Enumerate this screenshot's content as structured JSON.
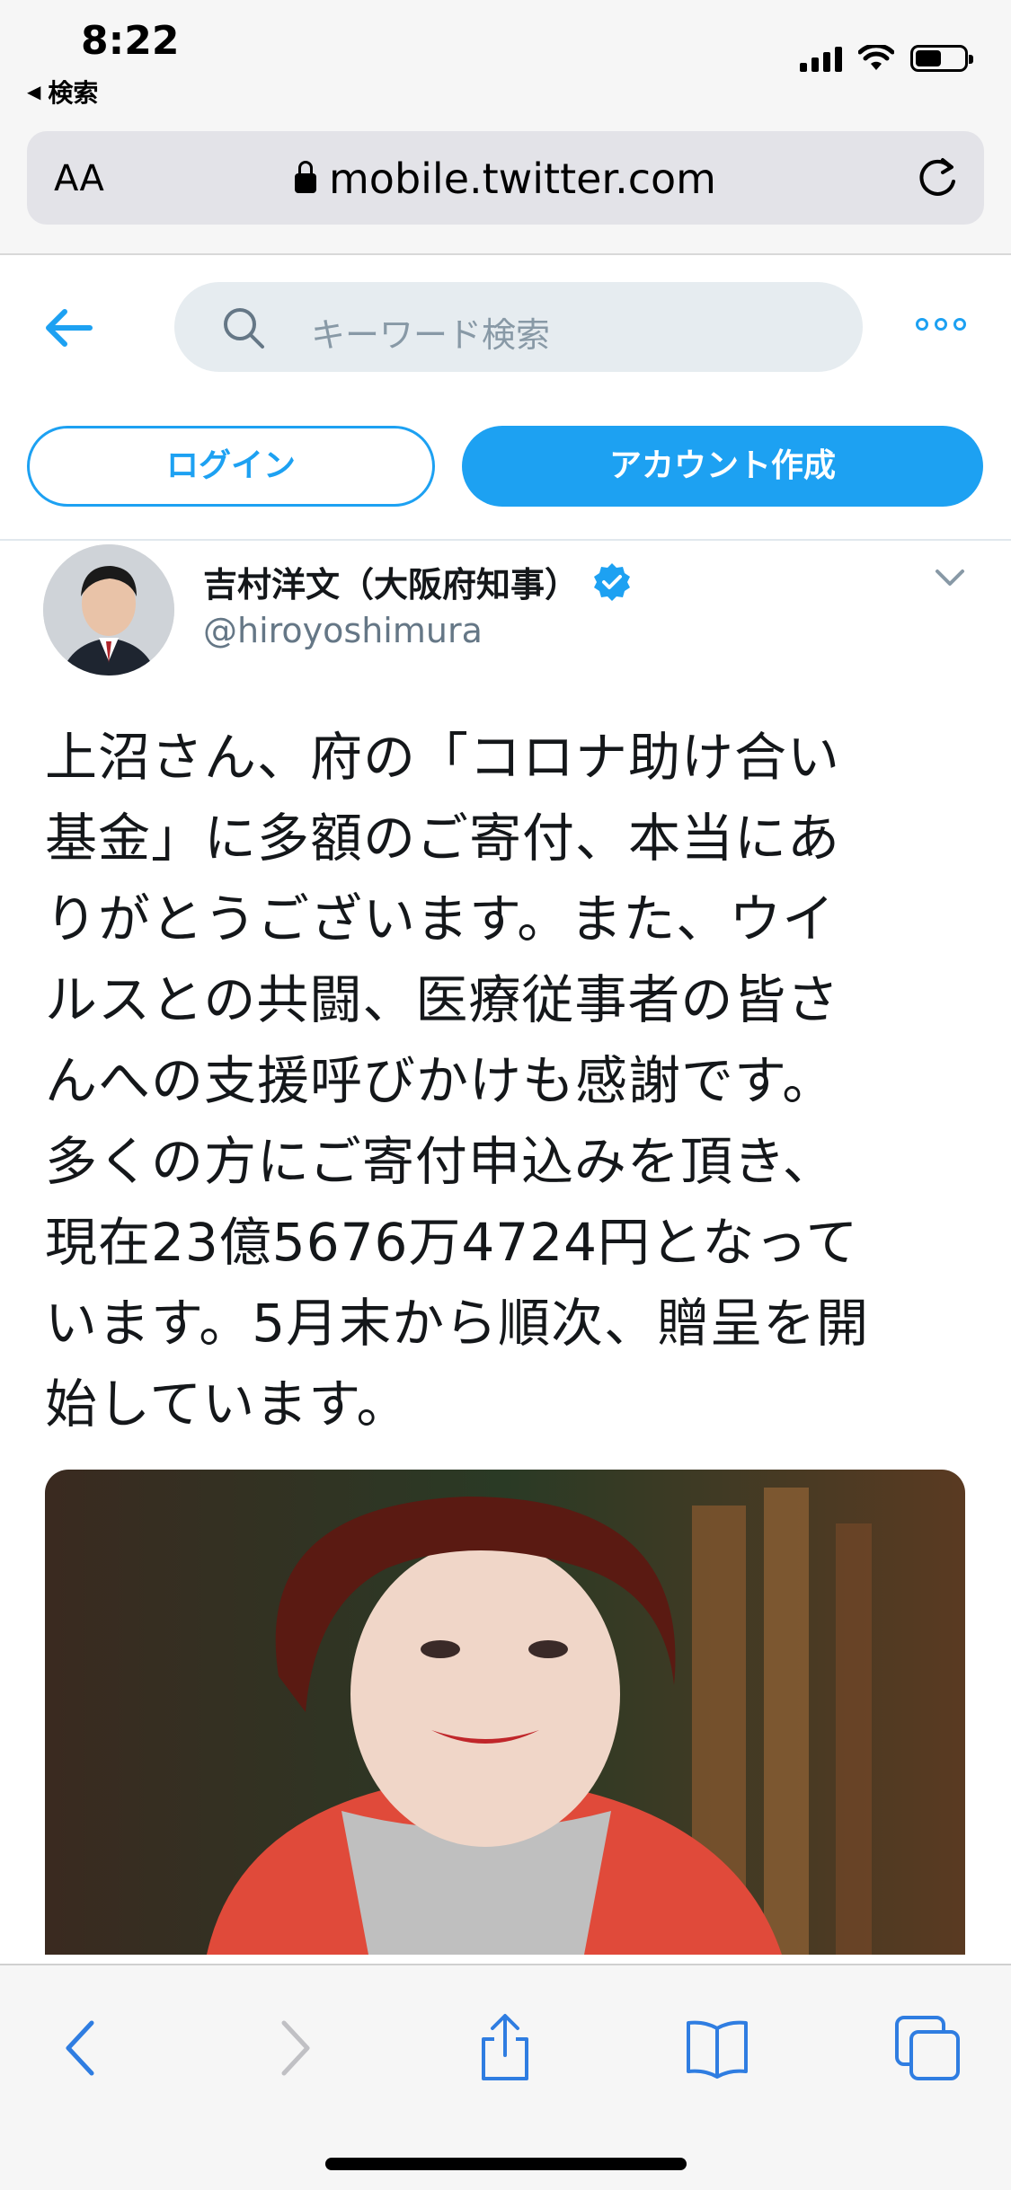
{
  "status_bar": {
    "time": "8:22",
    "back_label": "検索"
  },
  "url_bar": {
    "text_size_label": "AA",
    "domain": "mobile.twitter.com"
  },
  "twitter_header": {
    "search_placeholder": "キーワード検索"
  },
  "buttons": {
    "login": "ログイン",
    "signup": "アカウント作成"
  },
  "tweet": {
    "display_name": "吉村洋文（大阪府知事）",
    "handle": "@hiroyoshimura",
    "text": "上沼さん、府の「コロナ助け合い\n基金」に多額のご寄付、本当にあ\nりがとうございます。また、ウイ\nルスとの共闘、医療従事者の皆さ\nんへの支援呼びかけも感謝です。\n多くの方にご寄付申込みを頂き、\n現在23億5676万4724円となって\nいます。5月末から順次、贈呈を開\n始しています。"
  },
  "colors": {
    "twitter_blue": "#1da1f2",
    "safari_blue": "#2f7de1",
    "secondary_text": "#657786"
  }
}
